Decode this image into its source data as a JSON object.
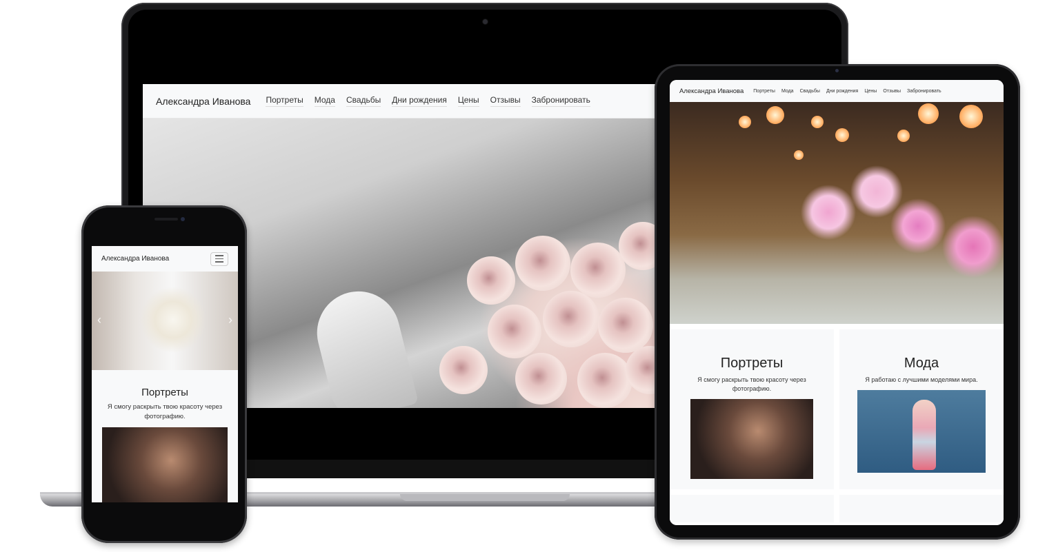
{
  "site": {
    "brand": "Александра Иванова",
    "nav": [
      "Портреты",
      "Мода",
      "Свадьбы",
      "Дни рождения",
      "Цены",
      "Отзывы",
      "Забронировать"
    ]
  },
  "cards": [
    {
      "title": "Портреты",
      "text": "Я смогу раскрыть твою красоту через фотографию."
    },
    {
      "title": "Мода",
      "text": "Я работаю с лучшими моделями мира."
    }
  ],
  "icons": {
    "menu": "hamburger-icon",
    "carousel_prev": "chevron-left-icon",
    "carousel_next": "chevron-right-icon"
  },
  "colors": {
    "navbar_bg": "#f8f9fa",
    "card_bg": "#f8f9fa",
    "device_frame": "#0b0b0c"
  }
}
